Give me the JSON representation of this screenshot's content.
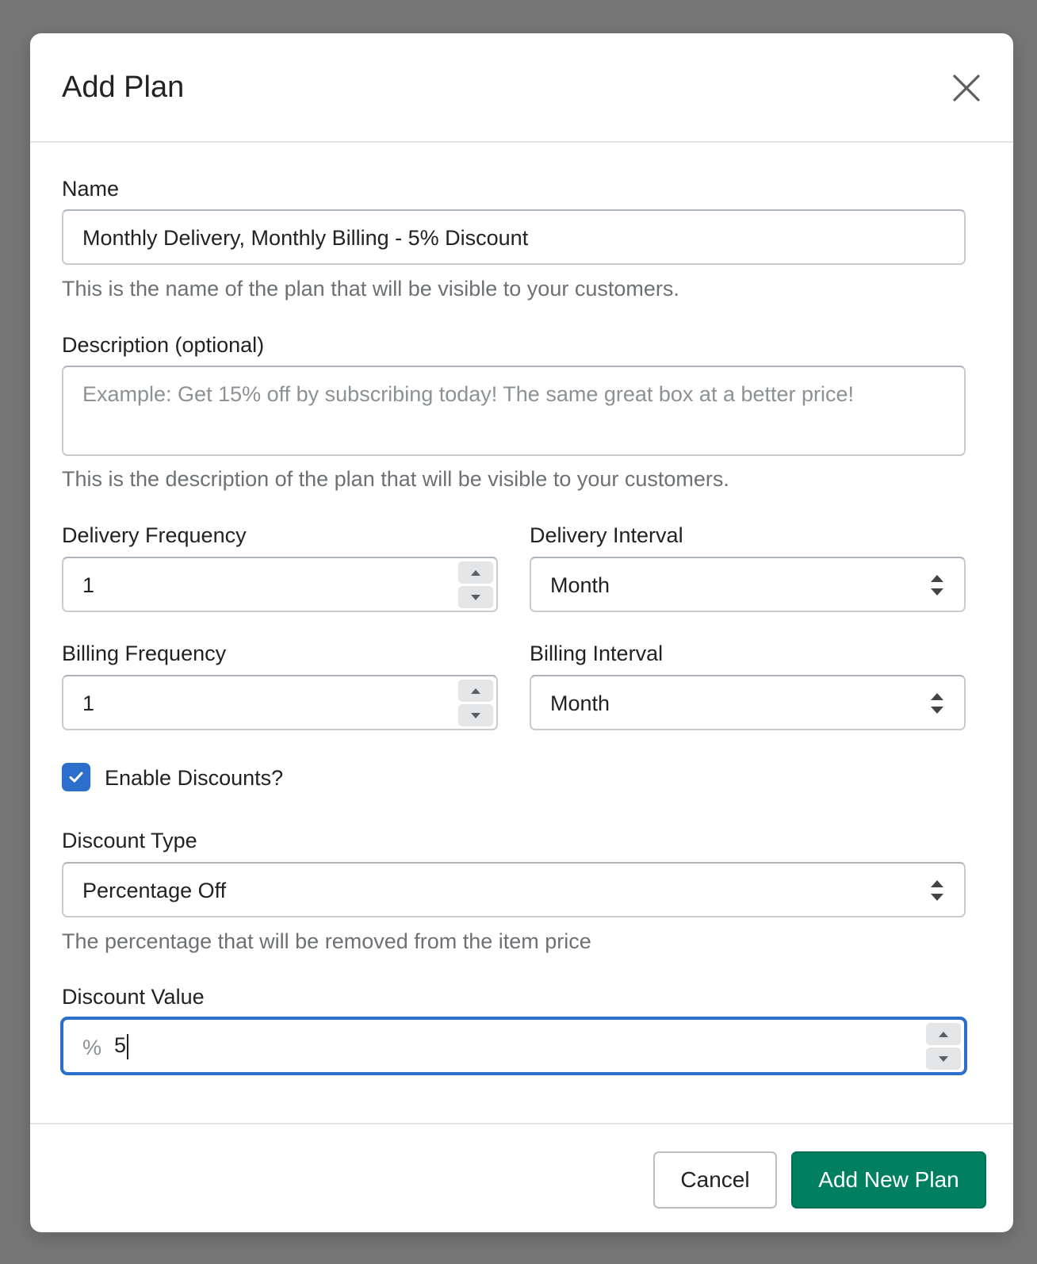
{
  "modal": {
    "title": "Add Plan"
  },
  "form": {
    "name": {
      "label": "Name",
      "value": "Monthly Delivery, Monthly Billing - 5% Discount",
      "help": "This is the name of the plan that will be visible to your customers."
    },
    "description": {
      "label": "Description (optional)",
      "placeholder": "Example: Get 15% off by subscribing today! The same great box at a better price!",
      "value": "",
      "help": "This is the description of the plan that will be visible to your customers."
    },
    "delivery_frequency": {
      "label": "Delivery Frequency",
      "value": "1"
    },
    "delivery_interval": {
      "label": "Delivery Interval",
      "selected": "Month"
    },
    "billing_frequency": {
      "label": "Billing Frequency",
      "value": "1"
    },
    "billing_interval": {
      "label": "Billing Interval",
      "selected": "Month"
    },
    "enable_discounts": {
      "label": "Enable Discounts?",
      "checked": true
    },
    "discount_type": {
      "label": "Discount Type",
      "selected": "Percentage Off",
      "help": "The percentage that will be removed from the item price"
    },
    "discount_value": {
      "label": "Discount Value",
      "prefix": "%",
      "value": "5"
    }
  },
  "footer": {
    "cancel_label": "Cancel",
    "submit_label": "Add New Plan"
  },
  "colors": {
    "accent": "#2c6ecb",
    "primary": "#008060",
    "backdrop": "#767676"
  },
  "icons": {
    "close": "close-icon",
    "checkbox": "checkmark-icon",
    "stepper_up": "caret-up-icon",
    "stepper_down": "caret-down-icon",
    "select": "select-arrows-icon"
  }
}
